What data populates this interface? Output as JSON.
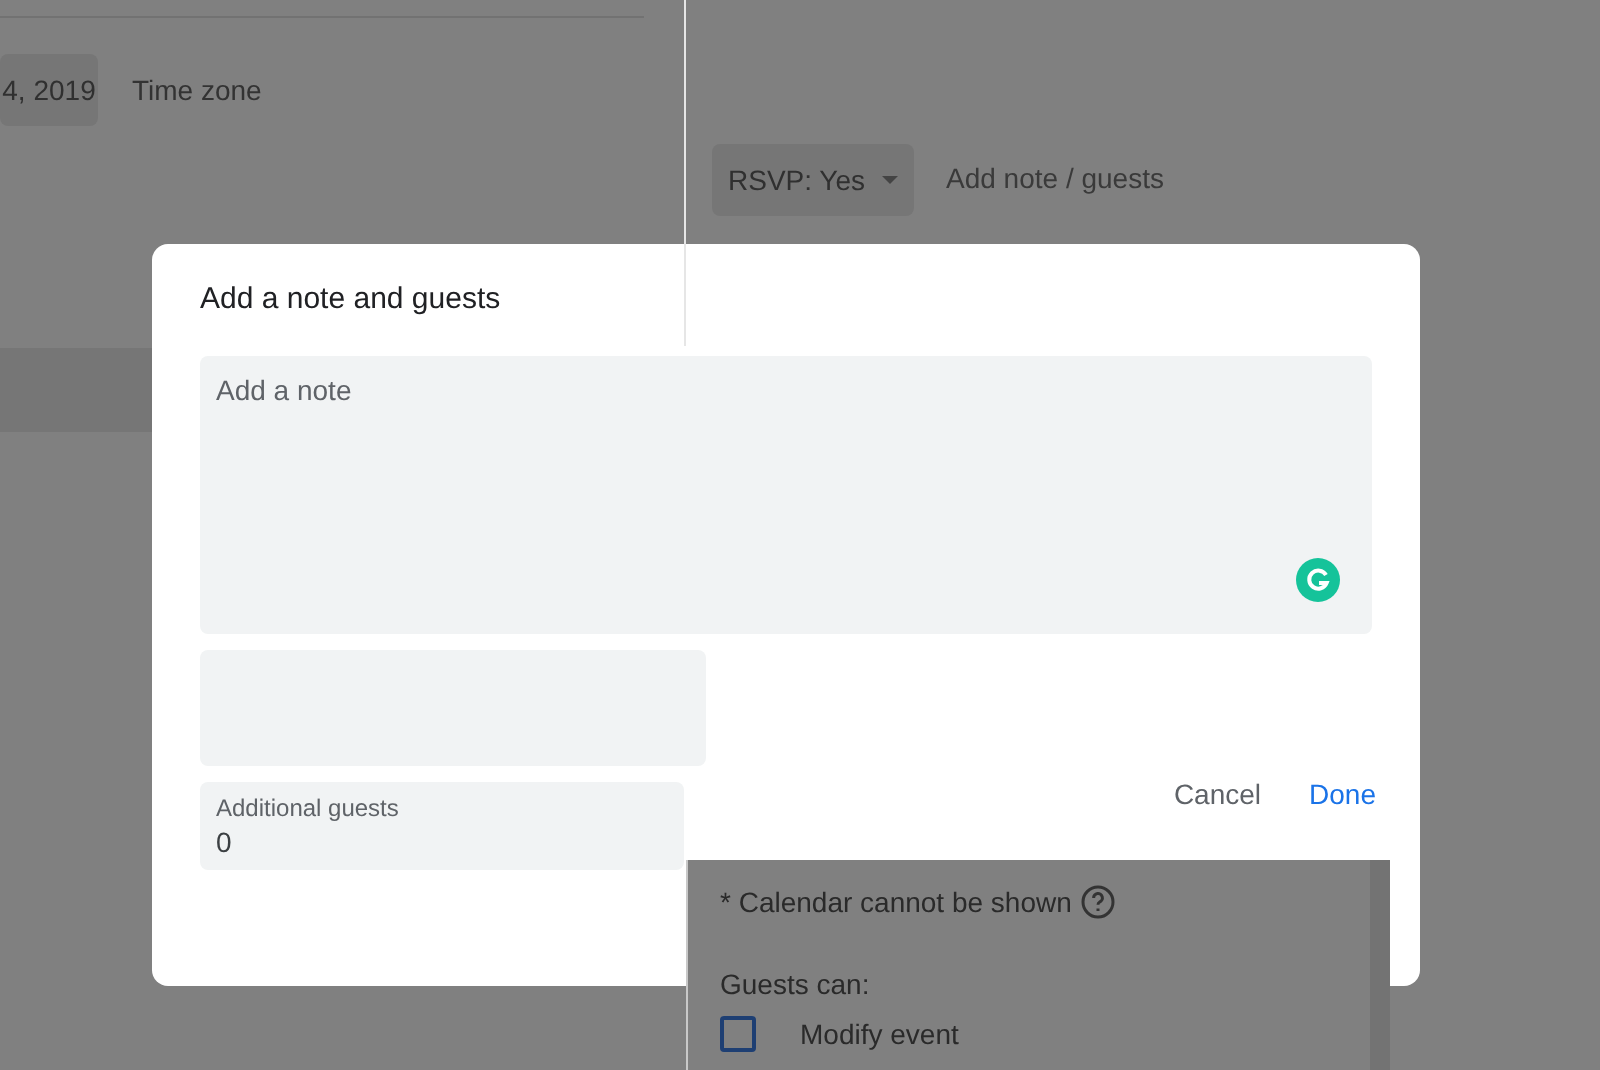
{
  "background": {
    "date_chip": "4, 2019",
    "time_zone": "Time zone",
    "rsvp": "RSVP: Yes",
    "add_note_link": "Add note / guests"
  },
  "dialog": {
    "title": "Add a note and guests",
    "note": {
      "placeholder": "Add a note"
    },
    "guests_field": {
      "label": "Additional guests",
      "value": "0"
    },
    "buttons": [
      {
        "label": "Cancel",
        "kind": "secondary"
      },
      {
        "label": "Done",
        "kind": "primary"
      }
    ]
  },
  "guest_panel": {
    "calendar_notice": "* Calendar cannot be shown",
    "guests_can": "Guests can:",
    "permissions": [
      {
        "label": "Modify event",
        "checked": false
      }
    ]
  }
}
